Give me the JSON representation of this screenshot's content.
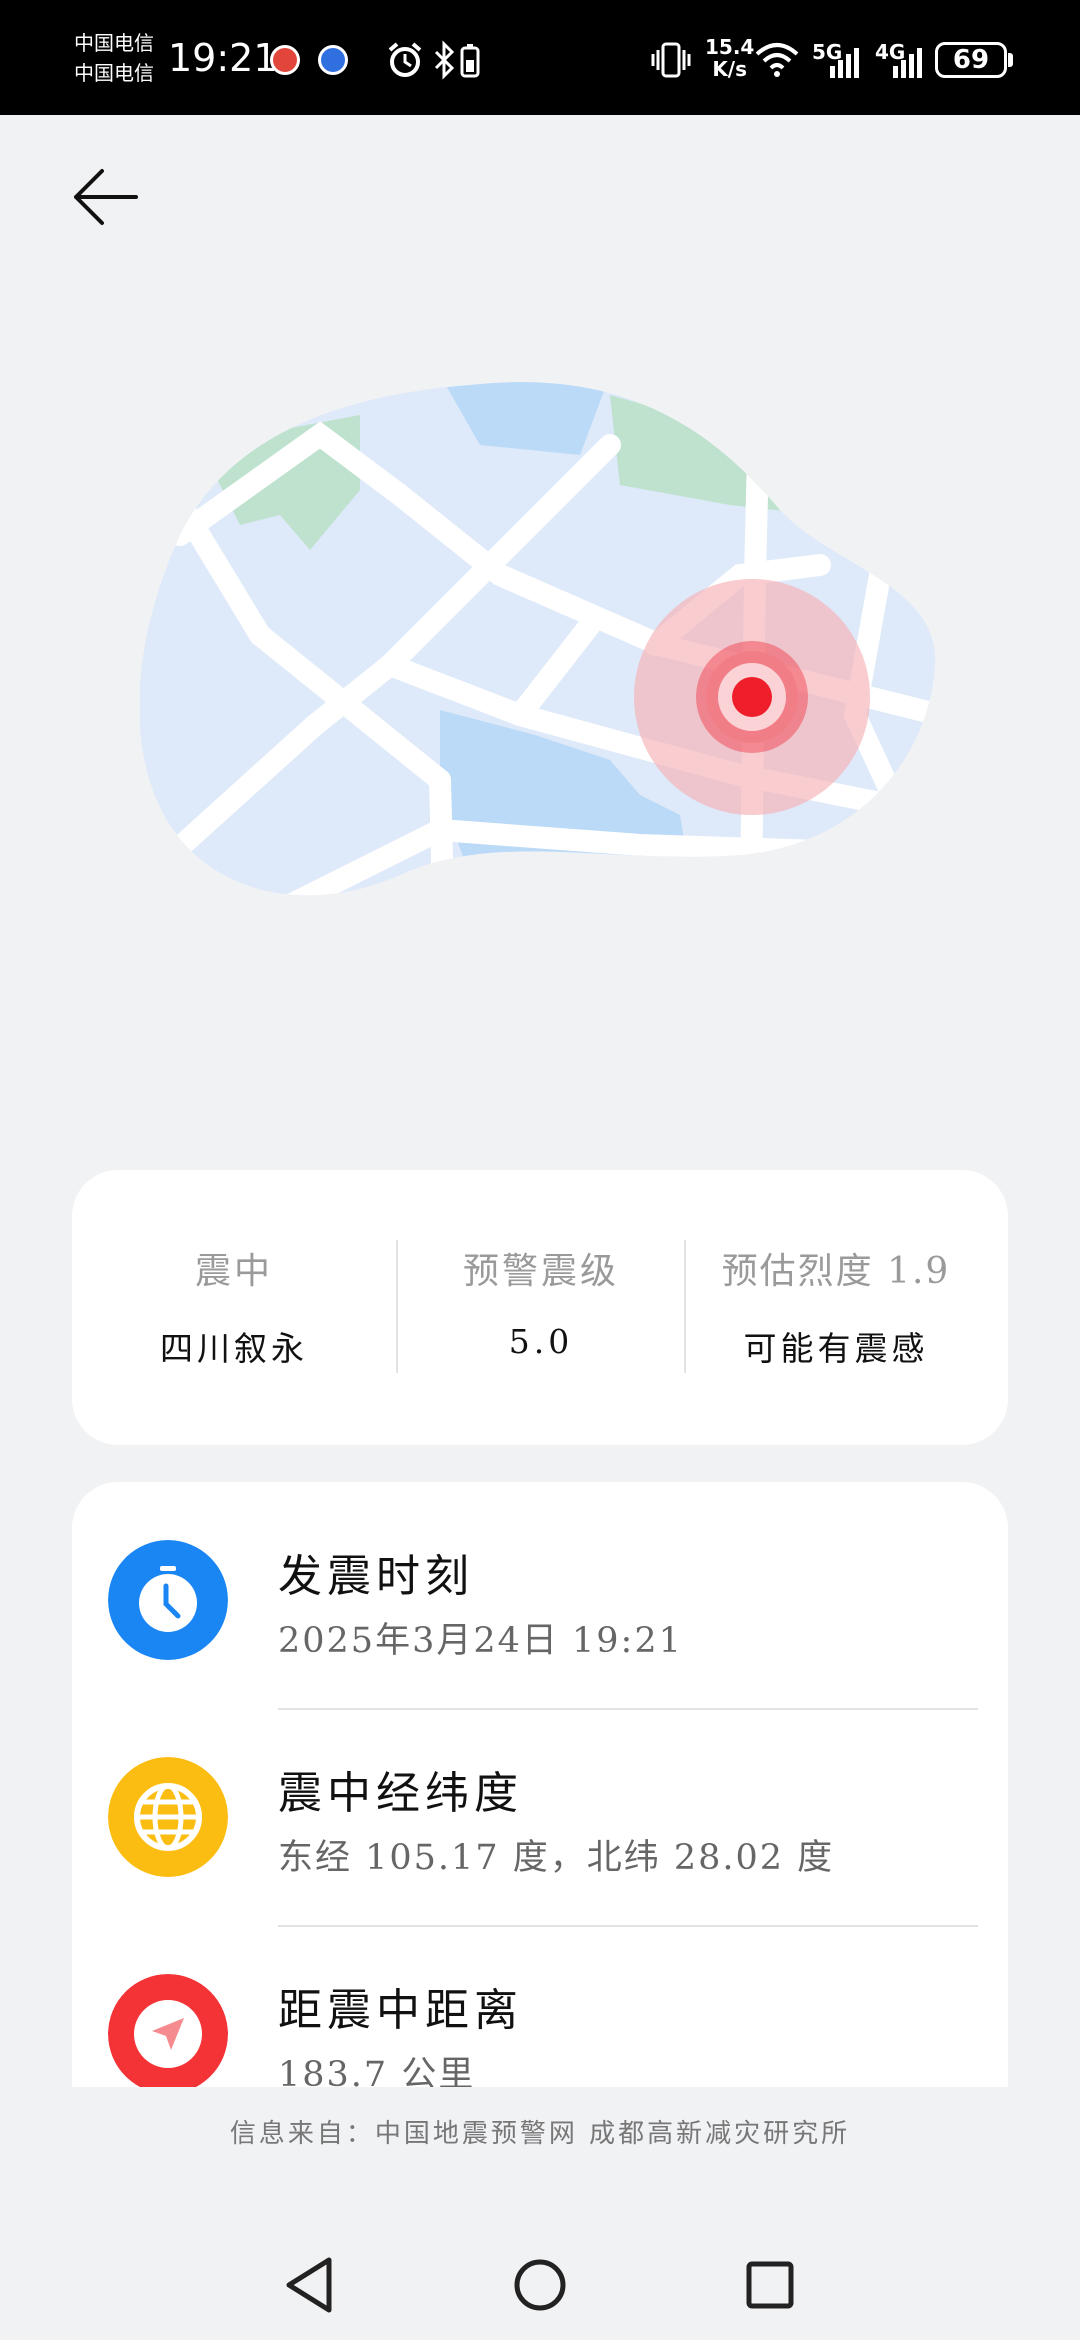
{
  "status_bar": {
    "carrier_1": "中国电信",
    "carrier_2": "中国电信",
    "time": "19:21",
    "net_speed_value": "15.4",
    "net_speed_unit": "K/s",
    "net_5g": "5G",
    "net_4g": "4G",
    "battery": "69"
  },
  "summary": {
    "epicenter_label": "震中",
    "epicenter_value": "四川叙永",
    "magnitude_label": "预警震级",
    "magnitude_value": "5.0",
    "intensity_label": "预估烈度 1.9",
    "intensity_value": "可能有震感"
  },
  "details": {
    "time_title": "发震时刻",
    "time_value": "2025年3月24日 19:21",
    "coords_title": "震中经纬度",
    "coords_value": "东经 105.17 度，北纬 28.02 度",
    "distance_title": "距震中距离",
    "distance_value": "183.7 公里"
  },
  "footer": {
    "source": "信息来自：中国地震预警网 成都高新减灾研究所"
  },
  "icons": {
    "back": "arrow-left-icon",
    "time": "clock-icon",
    "coords": "globe-icon",
    "distance": "navigation-arrow-icon",
    "epicenter_marker": "map-pin-pulse-icon"
  },
  "colors": {
    "clock_blue": "#1a86f4",
    "globe_yellow": "#fbbd12",
    "distance_red": "#f43336",
    "epicenter_red": "#ee1f2a",
    "map_land": "#dee9f9",
    "map_green": "#bfe2ce",
    "map_water": "#badaf7"
  }
}
